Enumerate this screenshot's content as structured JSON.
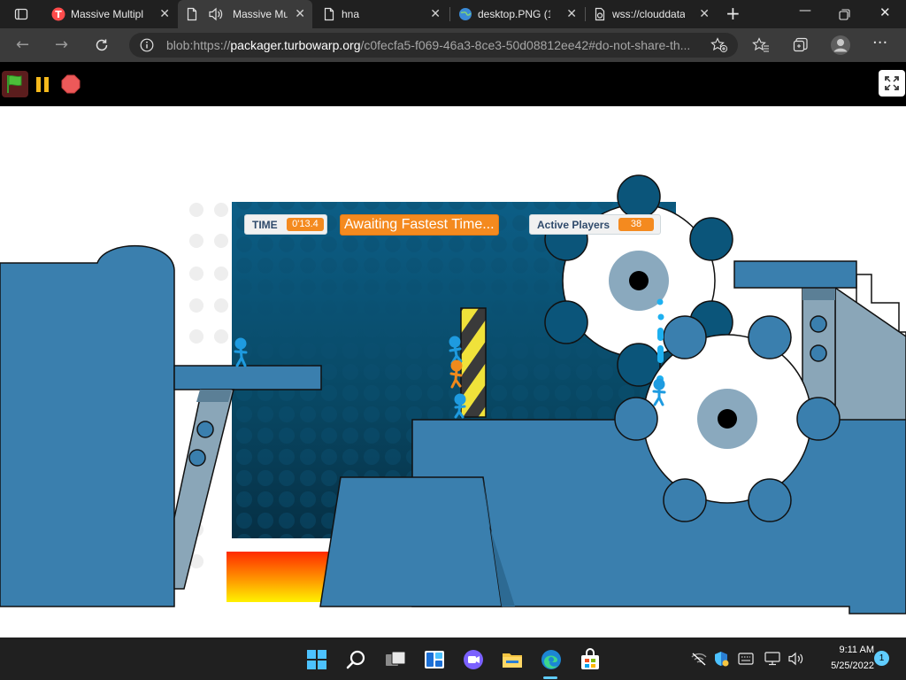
{
  "browser": {
    "tabs": [
      {
        "title": "Massive Multipla",
        "favicon": "turbowarp-icon",
        "active": false
      },
      {
        "title": "Massive Mu",
        "favicon": "page-icon",
        "audio": true,
        "active": true
      },
      {
        "title": "hna",
        "favicon": "page-icon",
        "active": false
      },
      {
        "title": "desktop.PNG (10",
        "favicon": "globe-icon",
        "active": false
      },
      {
        "title": "wss://clouddata.",
        "favicon": "page-icon",
        "active": false
      }
    ],
    "url_prefix": "blob:https://",
    "url_host": "packager.turbowarp.org",
    "url_rest": "/c0fecfa5-f069-46a3-8ce3-50d08812ee42#do-not-share-th..."
  },
  "game": {
    "hud": {
      "time_label": "TIME",
      "time_value": "0'13.4",
      "awaiting_text": "Awaiting Fastest Time...",
      "players_label": "Active Players",
      "players_value": "38"
    },
    "colors": {
      "platform": "#3a7fae",
      "background_dark": "#0f5f85",
      "hazard_yellow": "#f0e23a",
      "lava_top": "#ff2a00",
      "lava_bottom": "#fff200",
      "player_blue": "#1e9be0",
      "player_orange": "#f08a1c"
    }
  },
  "taskbar": {
    "time": "9:11 AM",
    "date": "5/25/2022",
    "notifications": "1",
    "apps": [
      "start-icon",
      "search-icon",
      "task-view-icon",
      "widgets-icon",
      "teams-chat-icon",
      "file-explorer-icon",
      "edge-icon",
      "store-icon"
    ]
  }
}
